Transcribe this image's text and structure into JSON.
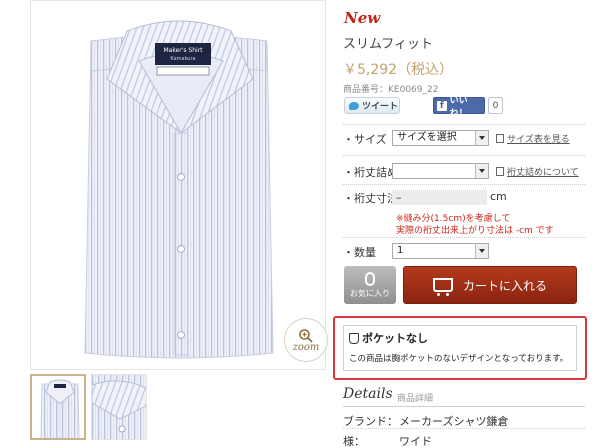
{
  "product": {
    "badge": "New",
    "name": "スリムフィット",
    "price": "￥5,292（税込）",
    "sku": "商品番号：KE0069_22"
  },
  "social": {
    "tweet_label": "ツイート",
    "like_label": "いいね！",
    "like_count": "0"
  },
  "options": {
    "size_label": "・サイズ",
    "size_value": "サイズを選択",
    "size_link": "サイズ表を見る",
    "sleeve_adjust_label": "・裄丈詰め",
    "sleeve_adjust_value": "",
    "sleeve_adjust_link": "裄丈詰めについて",
    "sleeve_length_label": "・裄丈寸法",
    "sleeve_length_value": "–",
    "sleeve_length_unit": "cm",
    "note_line1": "※縫み分(1.5cm)を考慮して",
    "note_line2": "実際の裄丈出来上がり寸法は -cm です",
    "quantity_label": "・数量",
    "quantity_value": "1"
  },
  "actions": {
    "favorite_label": "お気に入り",
    "cart_label": "カートに入れる"
  },
  "zoom_label": "zoom",
  "shirt_tag": {
    "line1": "Maker's Shirt",
    "line2": "Kamakura"
  },
  "pocket": {
    "title": "ポケットなし",
    "description": "この商品は胸ポケットのないデザインとなっております。"
  },
  "details": {
    "title": "Details",
    "subtitle": "商品詳細",
    "brand_label": "ブランド：",
    "brand_value": "メーカーズシャツ鎌倉",
    "style_label": "様：",
    "style_value": "ワイド"
  },
  "colors": {
    "accent_red": "#c0231a",
    "price_gold": "#c4a36a",
    "cart_brown": "#a8321a",
    "highlight_border": "#d63a3a"
  },
  "icons": {
    "zoom": "magnifier-icon",
    "favorite": "paperclip-icon",
    "cart": "cart-icon",
    "pocket": "pocket-icon",
    "tweet": "twitter-bird-icon",
    "like": "facebook-icon"
  }
}
